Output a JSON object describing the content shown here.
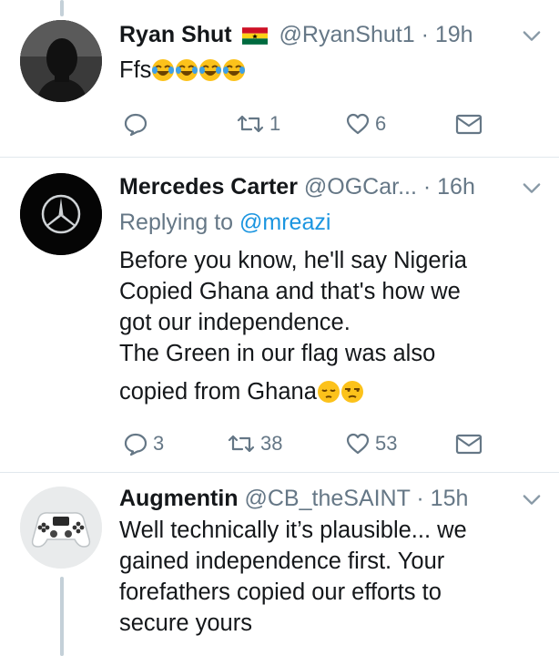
{
  "tweets": [
    {
      "name": "Ryan Shut",
      "handle": "@RyanShut1",
      "time": "· 19h",
      "replying_label": "",
      "replying_to": "",
      "body": "Ffs",
      "emojis": [
        "face-with-tears-of-joy",
        "face-with-tears-of-joy",
        "face-with-tears-of-joy",
        "face-with-tears-of-joy"
      ],
      "badge": "ghana-flag",
      "reply_count": "",
      "retweet_count": "1",
      "like_count": "6"
    },
    {
      "name": "Mercedes Carter",
      "handle": "@OGCar...",
      "time": "· 16h",
      "replying_label": "Replying to",
      "replying_to": "@mreazi",
      "body_lines": [
        "Before you know, he'll say Nigeria",
        "Copied Ghana and that's how we",
        "got our independence.",
        "The Green in our flag was also",
        "copied from Ghana"
      ],
      "emojis": [
        "pensive-face",
        "unamused-face"
      ],
      "reply_count": "3",
      "retweet_count": "38",
      "like_count": "53"
    },
    {
      "name": "Augmentin",
      "handle": "@CB_theSAINT",
      "time": "· 15h",
      "body_lines": [
        "Well technically it’s plausible... we",
        "gained independence first. Your",
        "forefathers copied our efforts to",
        "secure yours"
      ],
      "reply_count": "",
      "retweet_count": "",
      "like_count": ""
    }
  ],
  "colors": {
    "accent": "#1b95e0",
    "secondary_text": "#657786",
    "primary_text": "#14171a",
    "thread_line": "#c4d0d8",
    "separator": "#e1e8ed"
  }
}
